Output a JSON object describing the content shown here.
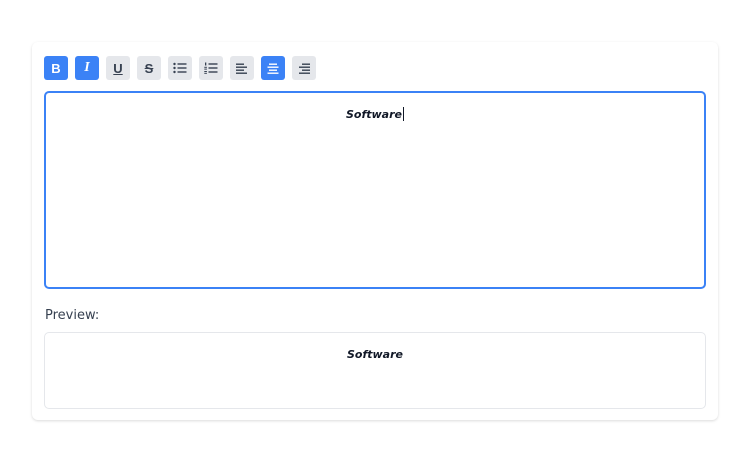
{
  "toolbar": {
    "buttons": [
      {
        "name": "bold",
        "glyph": "B",
        "icon": "bold-icon",
        "active": true
      },
      {
        "name": "italic",
        "glyph": "I",
        "icon": "italic-icon",
        "active": true
      },
      {
        "name": "underline",
        "glyph": "U",
        "icon": "underline-icon",
        "active": false
      },
      {
        "name": "strikethrough",
        "glyph": "S",
        "icon": "strikethrough-icon",
        "active": false
      },
      {
        "name": "bullet-list",
        "icon": "bullet-list-icon",
        "active": false
      },
      {
        "name": "numbered-list",
        "icon": "numbered-list-icon",
        "active": false
      },
      {
        "name": "align-left",
        "icon": "align-left-icon",
        "active": false
      },
      {
        "name": "align-center",
        "icon": "align-center-icon",
        "active": true
      },
      {
        "name": "align-right",
        "icon": "align-right-icon",
        "active": false
      }
    ]
  },
  "editor": {
    "content": "Software"
  },
  "preview": {
    "label": "Preview:",
    "content": "Software"
  },
  "colors": {
    "accent": "#3b82f6",
    "button_bg": "#e5e7eb",
    "border": "#e5e7eb",
    "text": "#111827"
  }
}
